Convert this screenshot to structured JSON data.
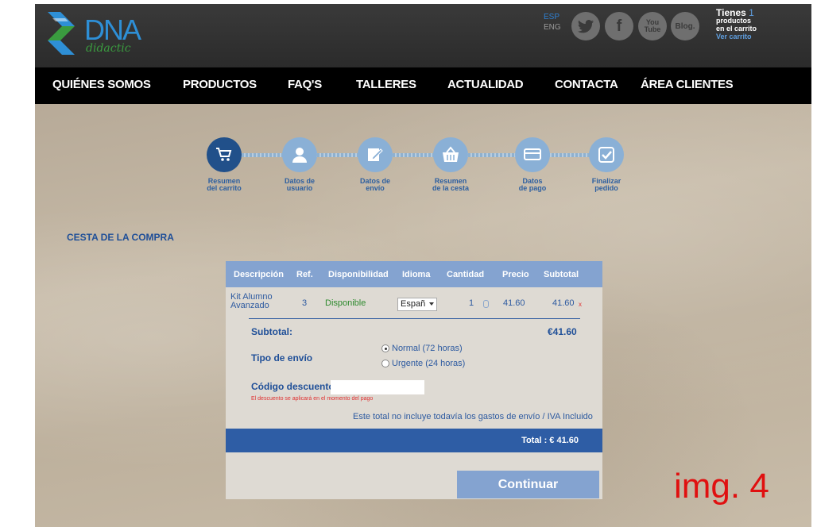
{
  "header": {
    "logo_text": "DNA",
    "logo_sub": "didactic",
    "lang_esp": "ESP",
    "lang_eng": "ENG",
    "social": {
      "twitter": "🐦",
      "facebook": "f",
      "youtube_top": "You",
      "youtube_bottom": "Tube",
      "blog": "Blog."
    },
    "cart": {
      "tienes": "Tienes",
      "count": "1",
      "line2": "productos",
      "line3": "en el carrito",
      "link": "Ver carrito"
    }
  },
  "nav": {
    "items": [
      "QUIÉNES SOMOS",
      "PRODUCTOS",
      "FAQ'S",
      "TALLERES",
      "ACTUALIDAD",
      "CONTACTA",
      "ÁREA CLIENTES"
    ]
  },
  "steps": [
    {
      "label1": "Resumen",
      "label2": "del carrito",
      "icon": "cart-icon"
    },
    {
      "label1": "Datos de",
      "label2": "usuario",
      "icon": "user-icon"
    },
    {
      "label1": "Datos de",
      "label2": "envío",
      "icon": "edit-icon"
    },
    {
      "label1": "Resumen",
      "label2": "de la cesta",
      "icon": "basket-icon"
    },
    {
      "label1": "Datos",
      "label2": "de pago",
      "icon": "card-icon"
    },
    {
      "label1": "Finalizar",
      "label2": "pedido",
      "icon": "check-icon"
    }
  ],
  "page_title": "CESTA DE LA COMPRA",
  "table": {
    "headers": [
      "Descripción",
      "Ref.",
      "Disponibilidad",
      "Idioma",
      "Cantidad",
      "Precio",
      "Subtotal"
    ],
    "row": {
      "desc1": "Kit Alumno",
      "desc2": "Avanzado",
      "ref": "3",
      "disp": "Disponible",
      "idioma": "Españ",
      "cantidad": "1",
      "precio": "41.60",
      "subtotal": "41.60",
      "remove": "x"
    }
  },
  "summary": {
    "subtotal_label": "Subtotal:",
    "subtotal_value": "€41.60",
    "envio_label": "Tipo de envío",
    "envio_normal": "Normal (72 horas)",
    "envio_urgente": "Urgente (24 horas)",
    "codigo_label": "Código descuento:",
    "codigo_note": "El descuento se aplicará en el momento del pago",
    "iva_note": "Este total no incluye todavía los gastos de envío / IVA Incluido",
    "total": "Total : € 41.60",
    "continue": "Continuar"
  },
  "tag": "img. 4",
  "colors": {
    "accent": "#2e5da5",
    "light_blue": "#84a3d0",
    "active_step": "#21508a"
  }
}
